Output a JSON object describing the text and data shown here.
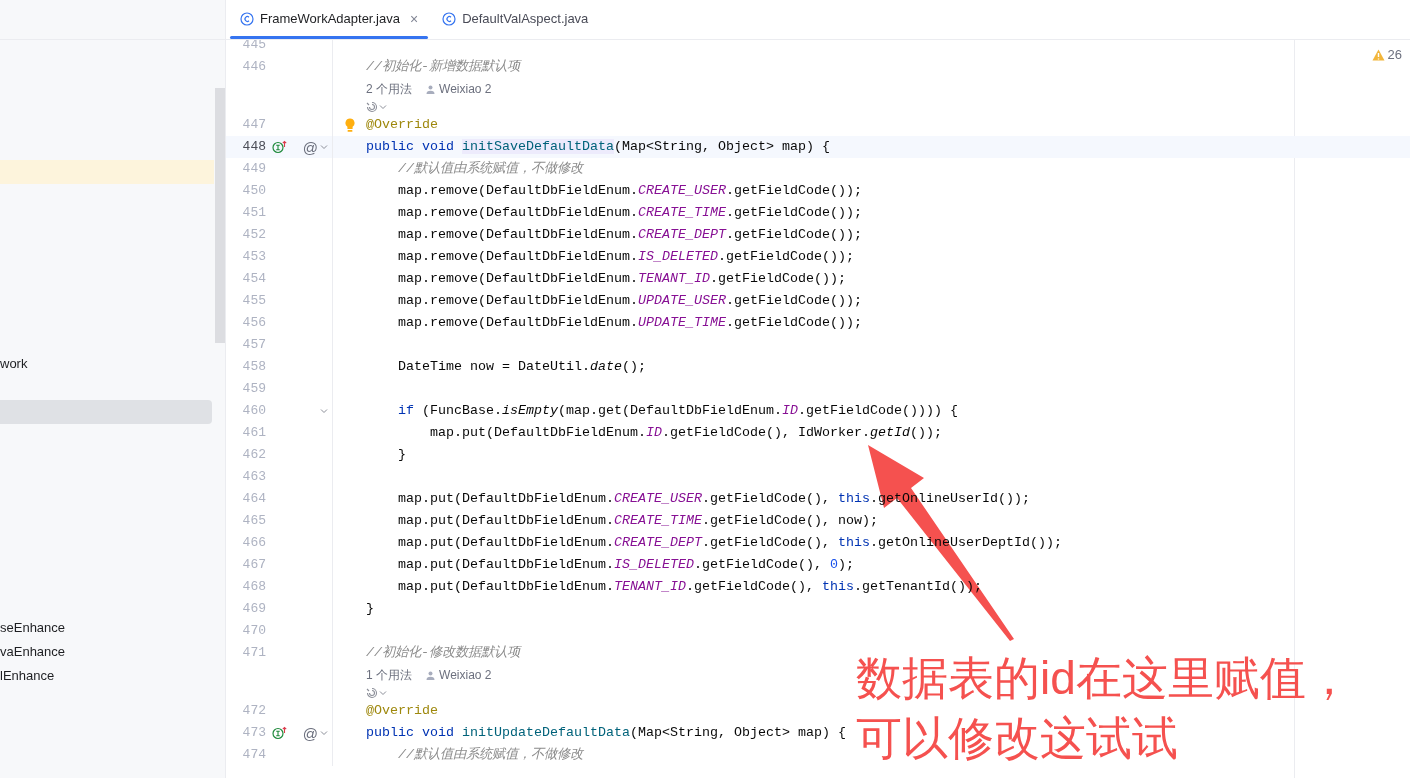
{
  "tabs": [
    {
      "label": "FrameWorkAdapter.java",
      "selected": true,
      "close_glyph": "×"
    },
    {
      "label": "DefaultValAspect.java",
      "selected": false
    }
  ],
  "sidebar": {
    "items": [
      {
        "highlighted": true,
        "selected": false
      },
      {
        "label": "work",
        "selected": false
      },
      {
        "selected": true
      },
      {
        "label": "seEnhance",
        "selected": false
      },
      {
        "label": "vaEnhance",
        "selected": false
      },
      {
        "label": "lEnhance",
        "selected": false
      }
    ]
  },
  "inspections": {
    "warnings": "26"
  },
  "editor": {
    "lines": [
      {
        "kind": "code",
        "number": "445"
      },
      {
        "kind": "code",
        "number": "446",
        "tokens": [
          {
            "kind": "comment",
            "text": "//初始化-新增数据默认项"
          }
        ]
      },
      {
        "kind": "hint",
        "usages": "2 个用法",
        "author": "Weixiao 2"
      },
      {
        "kind": "code",
        "number": "447",
        "bulb": true,
        "tokens": [
          {
            "kind": "annotation",
            "text": "@Override"
          }
        ]
      },
      {
        "kind": "code",
        "number": "448",
        "current": true,
        "implements": true,
        "at_glyph": "@",
        "tokens": [
          {
            "kind": "keyword",
            "text": "public void "
          },
          {
            "kind": "usage",
            "text": "initSaveDefaultData"
          },
          {
            "kind": "plain",
            "text": "(Map<String, Object> map) {"
          }
        ]
      },
      {
        "kind": "code",
        "number": "449",
        "tokens": [
          {
            "kind": "comment",
            "text": "    //默认值由系统赋值，不做修改"
          }
        ]
      },
      {
        "kind": "code",
        "number": "450",
        "tokens": [
          {
            "kind": "plain",
            "text": "    map.remove(DefaultDbFieldEnum."
          },
          {
            "kind": "constant",
            "text": "CREATE_USER"
          },
          {
            "kind": "plain",
            "text": ".getFieldCode());"
          }
        ]
      },
      {
        "kind": "code",
        "number": "451",
        "tokens": [
          {
            "kind": "plain",
            "text": "    map.remove(DefaultDbFieldEnum."
          },
          {
            "kind": "constant",
            "text": "CREATE_TIME"
          },
          {
            "kind": "plain",
            "text": ".getFieldCode());"
          }
        ]
      },
      {
        "kind": "code",
        "number": "452",
        "tokens": [
          {
            "kind": "plain",
            "text": "    map.remove(DefaultDbFieldEnum."
          },
          {
            "kind": "constant",
            "text": "CREATE_DEPT"
          },
          {
            "kind": "plain",
            "text": ".getFieldCode());"
          }
        ]
      },
      {
        "kind": "code",
        "number": "453",
        "tokens": [
          {
            "kind": "plain",
            "text": "    map.remove(DefaultDbFieldEnum."
          },
          {
            "kind": "constant",
            "text": "IS_DELETED"
          },
          {
            "kind": "plain",
            "text": ".getFieldCode());"
          }
        ]
      },
      {
        "kind": "code",
        "number": "454",
        "tokens": [
          {
            "kind": "plain",
            "text": "    map.remove(DefaultDbFieldEnum."
          },
          {
            "kind": "constant",
            "text": "TENANT_ID"
          },
          {
            "kind": "plain",
            "text": ".getFieldCode());"
          }
        ]
      },
      {
        "kind": "code",
        "number": "455",
        "tokens": [
          {
            "kind": "plain",
            "text": "    map.remove(DefaultDbFieldEnum."
          },
          {
            "kind": "constant",
            "text": "UPDATE_USER"
          },
          {
            "kind": "plain",
            "text": ".getFieldCode());"
          }
        ]
      },
      {
        "kind": "code",
        "number": "456",
        "tokens": [
          {
            "kind": "plain",
            "text": "    map.remove(DefaultDbFieldEnum."
          },
          {
            "kind": "constant",
            "text": "UPDATE_TIME"
          },
          {
            "kind": "plain",
            "text": ".getFieldCode());"
          }
        ]
      },
      {
        "kind": "code",
        "number": "457"
      },
      {
        "kind": "code",
        "number": "458",
        "tokens": [
          {
            "kind": "plain",
            "text": "    DateTime now = DateUtil."
          },
          {
            "kind": "static",
            "text": "date"
          },
          {
            "kind": "plain",
            "text": "();"
          }
        ]
      },
      {
        "kind": "code",
        "number": "459"
      },
      {
        "kind": "code",
        "number": "460",
        "fold": true,
        "tokens": [
          {
            "kind": "keyword",
            "text": "    if"
          },
          {
            "kind": "plain",
            "text": " (FuncBase."
          },
          {
            "kind": "static",
            "text": "isEmpty"
          },
          {
            "kind": "plain",
            "text": "(map.get(DefaultDbFieldEnum."
          },
          {
            "kind": "constant",
            "text": "ID"
          },
          {
            "kind": "plain",
            "text": ".getFieldCode()))) {"
          }
        ]
      },
      {
        "kind": "code",
        "number": "461",
        "tokens": [
          {
            "kind": "plain",
            "text": "        map.put(DefaultDbFieldEnum."
          },
          {
            "kind": "constant",
            "text": "ID"
          },
          {
            "kind": "plain",
            "text": ".getFieldCode(), IdWorker."
          },
          {
            "kind": "static",
            "text": "getId"
          },
          {
            "kind": "plain",
            "text": "());"
          }
        ]
      },
      {
        "kind": "code",
        "number": "462",
        "tokens": [
          {
            "kind": "plain",
            "text": "    }"
          }
        ]
      },
      {
        "kind": "code",
        "number": "463"
      },
      {
        "kind": "code",
        "number": "464",
        "tokens": [
          {
            "kind": "plain",
            "text": "    map.put(DefaultDbFieldEnum."
          },
          {
            "kind": "constant",
            "text": "CREATE_USER"
          },
          {
            "kind": "plain",
            "text": ".getFieldCode(), "
          },
          {
            "kind": "keyword",
            "text": "this"
          },
          {
            "kind": "plain",
            "text": ".getOnlineUserId());"
          }
        ]
      },
      {
        "kind": "code",
        "number": "465",
        "tokens": [
          {
            "kind": "plain",
            "text": "    map.put(DefaultDbFieldEnum."
          },
          {
            "kind": "constant",
            "text": "CREATE_TIME"
          },
          {
            "kind": "plain",
            "text": ".getFieldCode(), now);"
          }
        ]
      },
      {
        "kind": "code",
        "number": "466",
        "tokens": [
          {
            "kind": "plain",
            "text": "    map.put(DefaultDbFieldEnum."
          },
          {
            "kind": "constant",
            "text": "CREATE_DEPT"
          },
          {
            "kind": "plain",
            "text": ".getFieldCode(), "
          },
          {
            "kind": "keyword",
            "text": "this"
          },
          {
            "kind": "plain",
            "text": ".getOnlineUserDeptId());"
          }
        ]
      },
      {
        "kind": "code",
        "number": "467",
        "tokens": [
          {
            "kind": "plain",
            "text": "    map.put(DefaultDbFieldEnum."
          },
          {
            "kind": "constant",
            "text": "IS_DELETED"
          },
          {
            "kind": "plain",
            "text": ".getFieldCode(), "
          },
          {
            "kind": "number",
            "text": "0"
          },
          {
            "kind": "plain",
            "text": ");"
          }
        ]
      },
      {
        "kind": "code",
        "number": "468",
        "tokens": [
          {
            "kind": "plain",
            "text": "    map.put(DefaultDbFieldEnum."
          },
          {
            "kind": "constant",
            "text": "TENANT_ID"
          },
          {
            "kind": "plain",
            "text": ".getFieldCode(), "
          },
          {
            "kind": "keyword",
            "text": "this"
          },
          {
            "kind": "plain",
            "text": ".getTenantId());"
          }
        ]
      },
      {
        "kind": "code",
        "number": "469",
        "tokens": [
          {
            "kind": "plain",
            "text": "}"
          }
        ]
      },
      {
        "kind": "code",
        "number": "470"
      },
      {
        "kind": "code",
        "number": "471",
        "tokens": [
          {
            "kind": "comment",
            "text": "//初始化-修改数据默认项"
          }
        ]
      },
      {
        "kind": "hint",
        "usages": "1 个用法",
        "author": "Weixiao 2"
      },
      {
        "kind": "code",
        "number": "472",
        "tokens": [
          {
            "kind": "annotation",
            "text": "@Override"
          }
        ]
      },
      {
        "kind": "code",
        "number": "473",
        "implements": true,
        "at_glyph": "@",
        "tokens": [
          {
            "kind": "keyword",
            "text": "public void "
          },
          {
            "kind": "declaration",
            "text": "initUpdateDefaultData"
          },
          {
            "kind": "plain",
            "text": "(Map<String, Object> map) {"
          }
        ]
      },
      {
        "kind": "code",
        "number": "474",
        "tokens": [
          {
            "kind": "comment",
            "text": "    //默认值由系统赋值，不做修改"
          }
        ]
      }
    ]
  },
  "annotation": {
    "lines": [
      "数据表的id在这里赋值，",
      "可以修改这试试"
    ]
  }
}
